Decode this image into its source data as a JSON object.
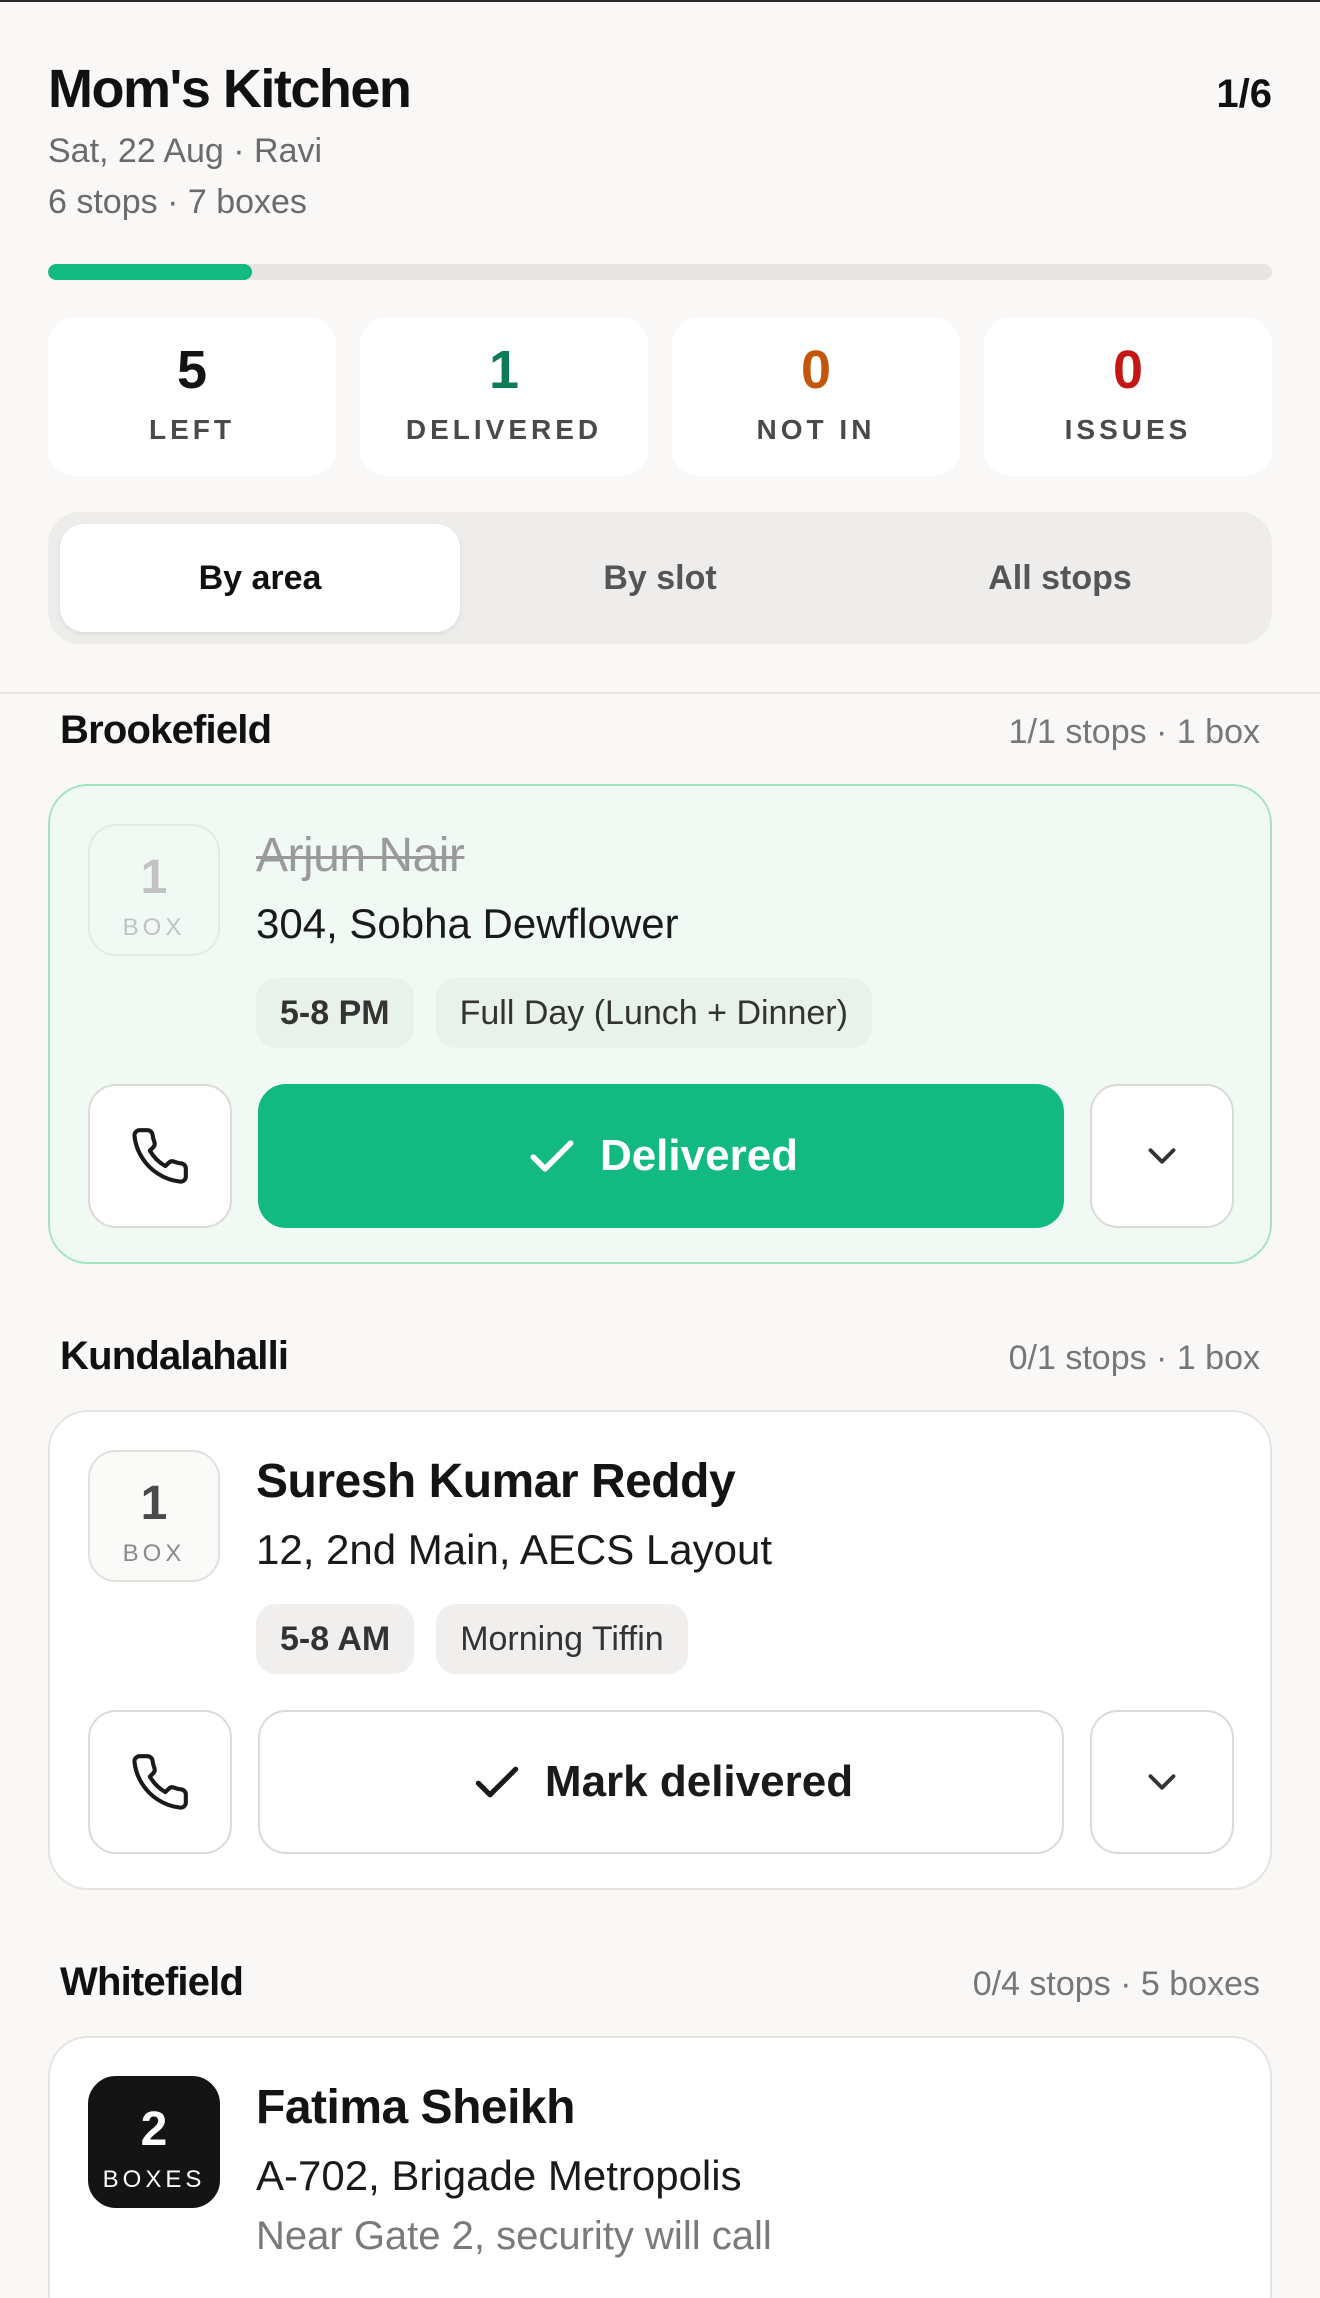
{
  "header": {
    "title": "Mom's Kitchen",
    "counter": "1/6",
    "date_driver": "Sat, 22 Aug · Ravi",
    "summary": "6 stops · 7 boxes"
  },
  "progress": {
    "fraction": 0.1667,
    "color": "#12b981"
  },
  "stats": [
    {
      "value": "5",
      "label": "LEFT",
      "color": "#141414"
    },
    {
      "value": "1",
      "label": "DELIVERED",
      "color": "#0f7a58"
    },
    {
      "value": "0",
      "label": "NOT IN",
      "color": "#c2570c"
    },
    {
      "value": "0",
      "label": "ISSUES",
      "color": "#c51616"
    }
  ],
  "segments": {
    "by_area": "By area",
    "by_slot": "By slot",
    "all_stops": "All stops",
    "active": "By area"
  },
  "groups": [
    {
      "name": "Brookefield",
      "meta": "1/1 stops · 1 box",
      "stop": {
        "box_count": "1",
        "box_label": "BOX",
        "customer": "Arjun Nair",
        "address": "304, Sobha Dewflower",
        "slot": "5-8 PM",
        "plan": "Full Day (Lunch + Dinner)",
        "status": "delivered",
        "action_label": "Delivered"
      }
    },
    {
      "name": "Kundalahalli",
      "meta": "0/1 stops · 1 box",
      "stop": {
        "box_count": "1",
        "box_label": "BOX",
        "customer": "Suresh Kumar Reddy",
        "address": "12, 2nd Main, AECS Layout",
        "slot": "5-8 AM",
        "plan": "Morning Tiffin",
        "status": "pending",
        "action_label": "Mark delivered"
      }
    },
    {
      "name": "Whitefield",
      "meta": "0/4 stops · 5 boxes",
      "stop": {
        "box_count": "2",
        "box_label": "BOXES",
        "customer": "Fatima Sheikh",
        "address": "A-702, Brigade Metropolis",
        "note": "Near Gate 2, security will call"
      }
    }
  ],
  "icons": {
    "call": "phone-icon",
    "check": "check-icon",
    "expand": "chevron-down-icon"
  }
}
